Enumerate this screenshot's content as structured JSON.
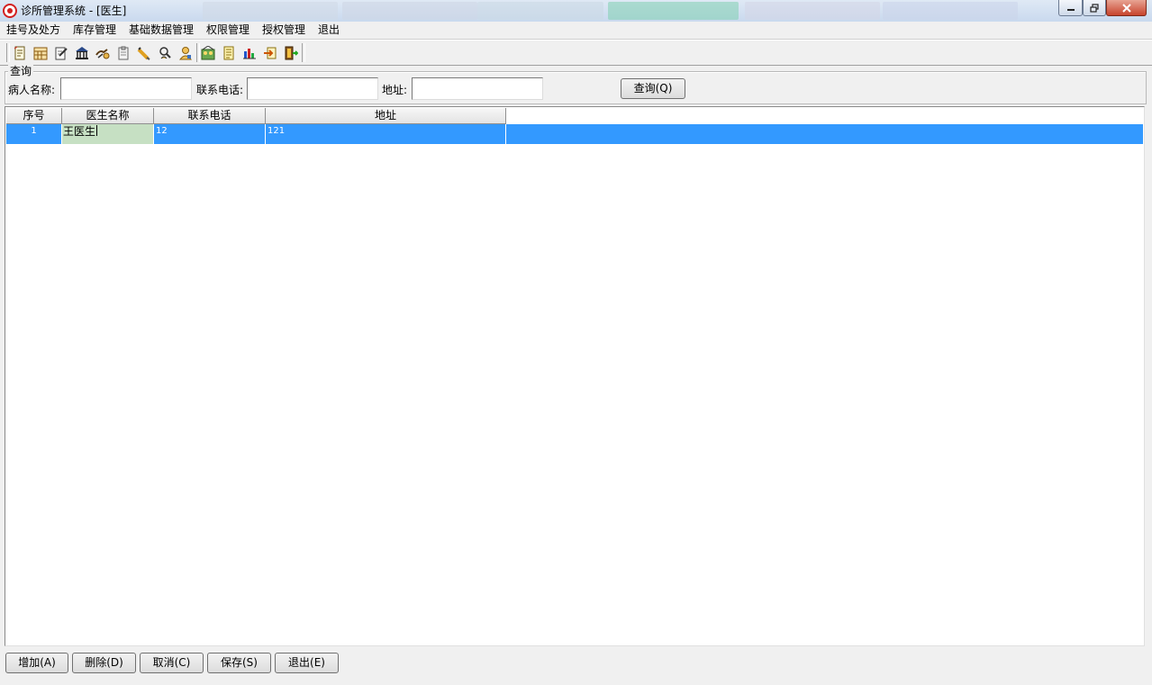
{
  "window": {
    "title": "诊所管理系统 - [医生]",
    "min_icon": "minimize-icon",
    "max_icon": "restore-icon",
    "close_icon": "close-icon"
  },
  "menu": [
    "挂号及处方",
    "库存管理",
    "基础数据管理",
    "权限管理",
    "授权管理",
    "退出"
  ],
  "toolbar": {
    "icons": [
      "register-icon",
      "calendar-icon",
      "edit-icon",
      "bank-icon",
      "handshake-icon",
      "clipboard-icon",
      "pencil-icon",
      "search-person-icon",
      "doctor-icon",
      "group-icon",
      "document-icon",
      "bar-chart-icon",
      "import-icon",
      "exit-door-icon"
    ]
  },
  "query": {
    "group_title": "查询",
    "patient_label": "病人名称:",
    "patient_value": "",
    "phone_label": "联系电话:",
    "phone_value": "",
    "address_label": "地址:",
    "address_value": "",
    "search_button": "查询(Q)"
  },
  "grid": {
    "columns": [
      "序号",
      "医生名称",
      "联系电话",
      "地址"
    ],
    "rows": [
      {
        "seq": "1",
        "name": "王医生",
        "phone": "12",
        "address": "121"
      }
    ]
  },
  "actions": {
    "add": "增加(A)",
    "delete": "删除(D)",
    "cancel": "取消(C)",
    "save": "保存(S)",
    "exit": "退出(E)"
  },
  "colors": {
    "selection": "#3399ff",
    "editing_cell": "#c6e0c3",
    "window_bg": "#f0f0f0"
  }
}
